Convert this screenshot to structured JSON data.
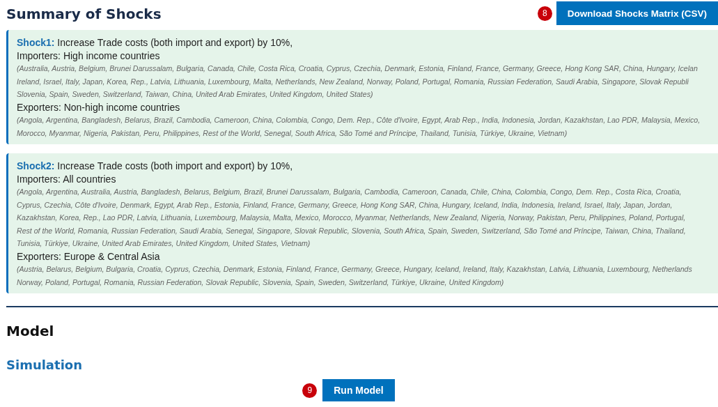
{
  "header": {
    "title": "Summary of Shocks",
    "badge": "8",
    "button": "Download Shocks Matrix (CSV)"
  },
  "shocks": [
    {
      "label": "Shock1:",
      "description": "Increase Trade costs (both import and export) by 10%,",
      "groups": [
        {
          "heading": "Importers: High income countries",
          "lines": [
            "(Australia, Austria, Belgium, Brunei Darussalam, Bulgaria, Canada, Chile, Costa Rica, Croatia, Cyprus, Czechia, Denmark, Estonia, Finland, France, Germany, Greece, Hong Kong SAR, China, Hungary, Icelan",
            "Ireland, Israel, Italy, Japan, Korea, Rep., Latvia, Lithuania, Luxembourg, Malta, Netherlands, New Zealand, Norway, Poland, Portugal, Romania, Russian Federation, Saudi Arabia, Singapore, Slovak Republi",
            "Slovenia, Spain, Sweden, Switzerland, Taiwan, China, United Arab Emirates, United Kingdom, United States)"
          ]
        },
        {
          "heading": "Exporters: Non-high income countries",
          "lines": [
            "(Angola, Argentina, Bangladesh, Belarus, Brazil, Cambodia, Cameroon, China, Colombia, Congo, Dem. Rep., Côte d'Ivoire, Egypt, Arab Rep., India, Indonesia, Jordan, Kazakhstan, Lao PDR, Malaysia, Mexico,",
            "Morocco, Myanmar, Nigeria, Pakistan, Peru, Philippines, Rest of the World, Senegal, South Africa, São Tomé and Príncipe, Thailand, Tunisia, Türkiye, Ukraine, Vietnam)"
          ]
        }
      ]
    },
    {
      "label": "Shock2:",
      "description": "Increase Trade costs (both import and export) by 10%,",
      "groups": [
        {
          "heading": "Importers: All countries",
          "lines": [
            "(Angola, Argentina, Australia, Austria, Bangladesh, Belarus, Belgium, Brazil, Brunei Darussalam, Bulgaria, Cambodia, Cameroon, Canada, Chile, China, Colombia, Congo, Dem. Rep., Costa Rica, Croatia,",
            "Cyprus, Czechia, Côte d'Ivoire, Denmark, Egypt, Arab Rep., Estonia, Finland, France, Germany, Greece, Hong Kong SAR, China, Hungary, Iceland, India, Indonesia, Ireland, Israel, Italy, Japan, Jordan,",
            "Kazakhstan, Korea, Rep., Lao PDR, Latvia, Lithuania, Luxembourg, Malaysia, Malta, Mexico, Morocco, Myanmar, Netherlands, New Zealand, Nigeria, Norway, Pakistan, Peru, Philippines, Poland, Portugal,",
            "Rest of the World, Romania, Russian Federation, Saudi Arabia, Senegal, Singapore, Slovak Republic, Slovenia, South Africa, Spain, Sweden, Switzerland, São Tomé and Príncipe, Taiwan, China, Thailand,",
            "Tunisia, Türkiye, Ukraine, United Arab Emirates, United Kingdom, United States, Vietnam)"
          ]
        },
        {
          "heading": "Exporters: Europe & Central Asia",
          "lines": [
            "(Austria, Belarus, Belgium, Bulgaria, Croatia, Cyprus, Czechia, Denmark, Estonia, Finland, France, Germany, Greece, Hungary, Iceland, Ireland, Italy, Kazakhstan, Latvia, Lithuania, Luxembourg, Netherlands",
            "Norway, Poland, Portugal, Romania, Russian Federation, Slovak Republic, Slovenia, Spain, Sweden, Switzerland, Türkiye, Ukraine, United Kingdom)"
          ]
        }
      ]
    }
  ],
  "model": {
    "title": "Model",
    "subtitle": "Simulation",
    "badge": "9",
    "button": "Run Model"
  }
}
